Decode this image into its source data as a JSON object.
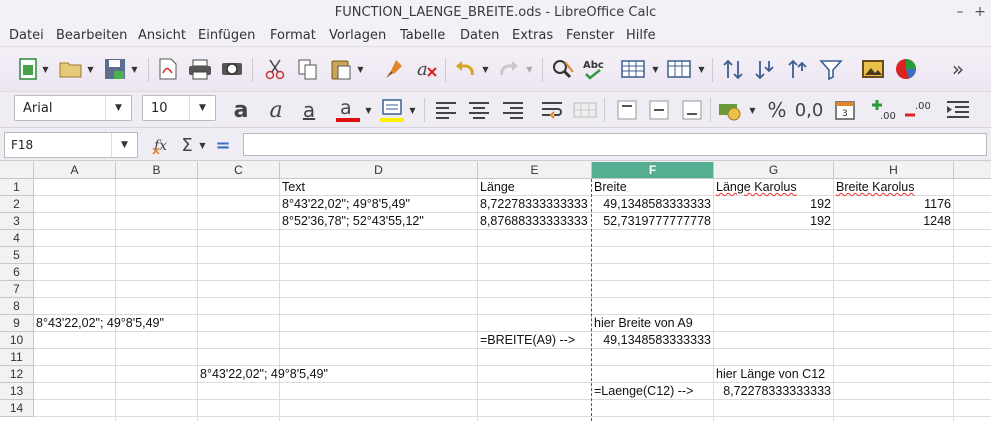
{
  "window": {
    "title": "FUNCTION_LAENGE_BREITE.ods - LibreOffice Calc",
    "minimize": "–",
    "close": "+"
  },
  "menu": [
    "Datei",
    "Bearbeiten",
    "Ansicht",
    "Einfügen",
    "Format",
    "Vorlagen",
    "Tabelle",
    "Daten",
    "Extras",
    "Fenster",
    "Hilfe"
  ],
  "toolbar1_overflow": "»",
  "font": {
    "name": "Arial",
    "size": "10"
  },
  "formula": {
    "cell_ref": "F18",
    "content": "",
    "equals": "="
  },
  "columns": [
    "A",
    "B",
    "C",
    "D",
    "E",
    "F",
    "G",
    "H"
  ],
  "active_column": "F",
  "rows": [
    "1",
    "2",
    "3",
    "4",
    "5",
    "6",
    "7",
    "8",
    "9",
    "10",
    "11",
    "12",
    "13",
    "14"
  ],
  "cells": {
    "D1": "Text",
    "E1": "Länge",
    "F1": "Breite",
    "G1": "Länge Karolus",
    "H1": "Breite Karolus",
    "D2": "8°43'22,02\"; 49°8'5,49\"",
    "E2": "8,72278333333333",
    "F2": "49,1348583333333",
    "G2": "192",
    "H2": "1176",
    "D3": "8°52'36,78\"; 52°43'55,12\"",
    "E3": "8,87688333333333",
    "F3": "52,7319777777778",
    "G3": "192",
    "H3": "1248",
    "A9": "8°43'22,02\"; 49°8'5,49\"",
    "F9": "hier Breite von A9",
    "E10": "=BREITE(A9) -->",
    "F10": "49,1348583333333",
    "C12": "8°43'22,02\"; 49°8'5,49\"",
    "G12": "hier Länge von C12",
    "F13": "=Laenge(C12) -->",
    "G13": "8,72278333333333"
  },
  "colors": {
    "active_header": "#55ad92",
    "menubar_bg": "#f3f0f6"
  }
}
